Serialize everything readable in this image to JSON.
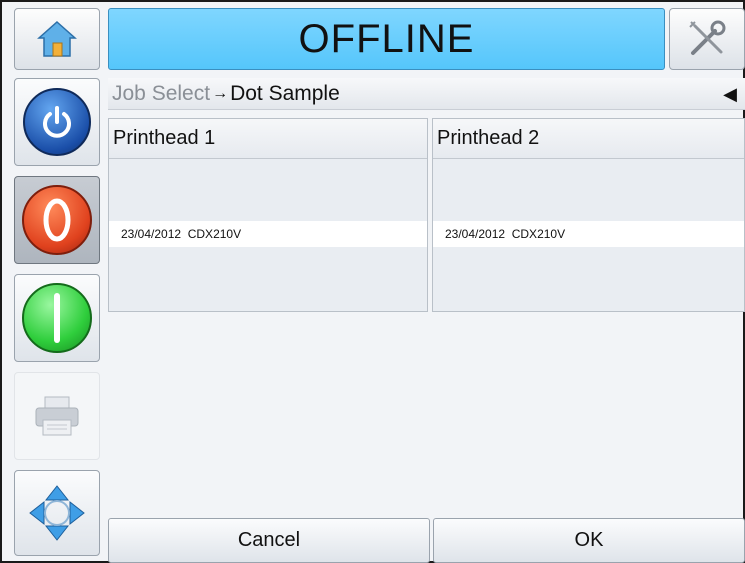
{
  "header": {
    "status_text": "OFFLINE",
    "home_icon": "home-icon",
    "tools_icon": "tools-icon",
    "status_color": "#5cc8fc"
  },
  "breadcrumb": {
    "parent": "Job Select",
    "separator": "→",
    "current": "Dot Sample",
    "back_glyph": "◀"
  },
  "sidebar": {
    "items": [
      {
        "name": "power",
        "icon": "power-icon",
        "color": "#1a4ea8"
      },
      {
        "name": "stop",
        "icon": "stop-icon",
        "color": "#e0421e"
      },
      {
        "name": "start",
        "icon": "start-icon",
        "color": "#2fce3c"
      },
      {
        "name": "print",
        "icon": "printer-icon",
        "state": "disabled"
      },
      {
        "name": "navigate",
        "icon": "navigation-arrows-icon"
      }
    ]
  },
  "printheads": [
    {
      "title": "Printhead 1",
      "selected_row": "23/04/2012  CDX210V"
    },
    {
      "title": "Printhead 2",
      "selected_row": "23/04/2012  CDX210V"
    }
  ],
  "actions": {
    "cancel_label": "Cancel",
    "ok_label": "OK"
  }
}
